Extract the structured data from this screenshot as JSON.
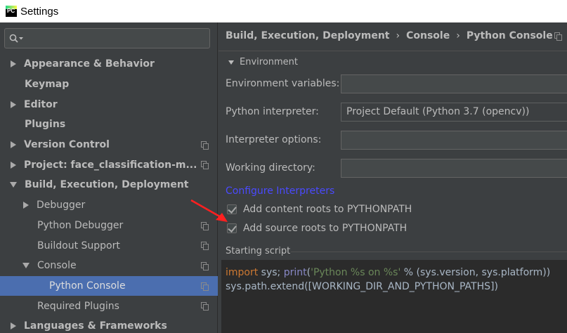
{
  "window": {
    "title": "Settings",
    "app_icon_text": "PC"
  },
  "search": {
    "placeholder": "",
    "value": ""
  },
  "sidebar": {
    "items": [
      {
        "label": "Appearance & Behavior",
        "level": 1,
        "arrow": "right",
        "copy": false
      },
      {
        "label": "Keymap",
        "level": 1,
        "arrow": "none",
        "copy": false
      },
      {
        "label": "Editor",
        "level": 1,
        "arrow": "right",
        "copy": false
      },
      {
        "label": "Plugins",
        "level": 1,
        "arrow": "none",
        "copy": false
      },
      {
        "label": "Version Control",
        "level": 1,
        "arrow": "right",
        "copy": true
      },
      {
        "label": "Project: face_classification-m...",
        "level": 1,
        "arrow": "right",
        "copy": true
      },
      {
        "label": "Build, Execution, Deployment",
        "level": 1,
        "arrow": "down",
        "copy": false
      },
      {
        "label": "Debugger",
        "level": 2,
        "arrow": "right",
        "copy": false
      },
      {
        "label": "Python Debugger",
        "level": 2,
        "arrow": "none",
        "copy": true
      },
      {
        "label": "Buildout Support",
        "level": 2,
        "arrow": "none",
        "copy": true
      },
      {
        "label": "Console",
        "level": 2,
        "arrow": "down",
        "copy": true
      },
      {
        "label": "Python Console",
        "level": 3,
        "arrow": "none",
        "copy": true,
        "selected": true
      },
      {
        "label": "Required Plugins",
        "level": 2,
        "arrow": "none",
        "copy": true
      },
      {
        "label": "Languages & Frameworks",
        "level": 1,
        "arrow": "right",
        "copy": false
      }
    ]
  },
  "breadcrumb": {
    "items": [
      "Build, Execution, Deployment",
      "Console",
      "Python Console"
    ],
    "separator": "›"
  },
  "environment": {
    "section_label": "Environment",
    "env_vars_label": "Environment variables:",
    "env_vars_value": "",
    "interpreter_label": "Python interpreter:",
    "interpreter_value": "Project Default (Python 3.7 (opencv))",
    "interpreter_options_label": "Interpreter options:",
    "interpreter_options_value": "",
    "working_dir_label": "Working directory:",
    "working_dir_value": "",
    "configure_link": "Configure Interpreters"
  },
  "checkboxes": {
    "content_roots": {
      "label": "Add content roots to PYTHONPATH",
      "checked": true
    },
    "source_roots": {
      "label": "Add source roots to PYTHONPATH",
      "checked": true
    }
  },
  "starting_script": {
    "label": "Starting script",
    "line1": {
      "kw": "import",
      "a": " sys; ",
      "fn": "print",
      "b": "(",
      "str": "'Python %s on %s'",
      "c": " % (sys.version, sys.platform))"
    },
    "line2": "sys.path.extend([WORKING_DIR_AND_PYTHON_PATHS])"
  },
  "colors": {
    "background": "#3c3f41",
    "selection": "#4b6eaf",
    "link": "#4a4aff",
    "keyword": "#cc7832",
    "builtin": "#8888c6",
    "string": "#6a8759",
    "annotation_arrow": "#ff2020"
  },
  "icons": {
    "search": "search-icon",
    "copy": "copy-icon",
    "expand": "chevron-right-icon",
    "collapse": "chevron-down-icon",
    "checkbox": "checkbox-checked-icon"
  }
}
